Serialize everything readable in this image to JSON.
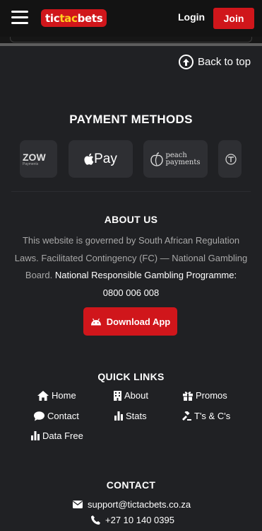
{
  "header": {
    "logo_part1": "tic",
    "logo_part2": "tac",
    "logo_part3": "bets",
    "login_label": "Login",
    "join_label": "Join"
  },
  "back_to_top": {
    "label": "Back to top",
    "icon": "arrow-up-circle-icon"
  },
  "payment_methods": {
    "title": "PAYMENT METHODS",
    "providers": [
      {
        "name": "ozow",
        "text": "ZOW",
        "sub": "Payments"
      },
      {
        "name": "apple-pay",
        "text": "Pay"
      },
      {
        "name": "peach-payments",
        "text_line1": "peach",
        "text_line2": "payments"
      },
      {
        "name": "partial-logo",
        "text": "T"
      }
    ]
  },
  "about": {
    "title": "ABOUT US",
    "text_plain": "This website is governed by South African Regulation Laws. Facilitated Contingency (FC) — National Gambling Board.",
    "text_highlight": "National Responsible Gambling Programme: 0800 006 008"
  },
  "download": {
    "label": "Download App",
    "icon": "android-icon"
  },
  "quick_links": {
    "title": "QUICK LINKS",
    "items": [
      {
        "label": "Home",
        "icon": "home-icon"
      },
      {
        "label": "About",
        "icon": "building-icon"
      },
      {
        "label": "Promos",
        "icon": "gift-icon"
      },
      {
        "label": "Contact",
        "icon": "chat-icon"
      },
      {
        "label": "Stats",
        "icon": "bar-chart-icon"
      },
      {
        "label": "T's & C's",
        "icon": "gavel-icon"
      },
      {
        "label": "Data Free",
        "icon": "bar-chart-icon"
      }
    ]
  },
  "contact": {
    "title": "CONTACT",
    "email": "support@tictacbets.co.za",
    "phone": "+27 10 140 0395"
  },
  "colors": {
    "brand_red": "#d0161b",
    "logo_yellow": "#ffd11f",
    "background": "#202124",
    "card": "#2e2f33"
  }
}
